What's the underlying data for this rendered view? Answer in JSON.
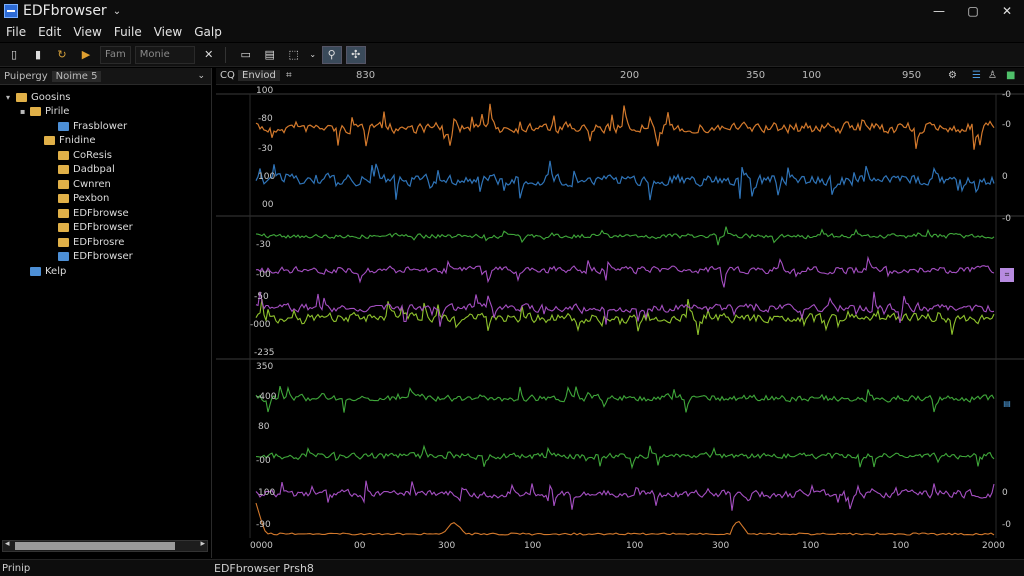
{
  "window": {
    "title": "EDFbrowser",
    "chevron": "⌄",
    "controls": [
      "—",
      "▢",
      "✕"
    ]
  },
  "menu": [
    "File",
    "Edit",
    "View",
    "Fuile",
    "View",
    "Galp"
  ],
  "toolbar": {
    "field1": "Fam",
    "field2": "Monie",
    "close": "✕"
  },
  "left_panel": {
    "tabs": [
      "Puipergy",
      "Noime 5"
    ],
    "tree": [
      {
        "label": "Goosins",
        "indent": 0,
        "icon": "folder",
        "expander": "▾"
      },
      {
        "label": "Pirile",
        "indent": 1,
        "icon": "folder",
        "expander": "▪"
      },
      {
        "label": "Frasblower",
        "indent": 3,
        "icon": "folder-blue",
        "expander": ""
      },
      {
        "label": "Fnidine",
        "indent": 2,
        "icon": "folder",
        "expander": ""
      },
      {
        "label": "CoResis",
        "indent": 3,
        "icon": "folder",
        "expander": ""
      },
      {
        "label": "Dadbpal",
        "indent": 3,
        "icon": "folder",
        "expander": ""
      },
      {
        "label": "Cwnren",
        "indent": 3,
        "icon": "folder",
        "expander": ""
      },
      {
        "label": "Pexbon",
        "indent": 3,
        "icon": "folder",
        "expander": ""
      },
      {
        "label": "EDFbrowse",
        "indent": 3,
        "icon": "folder",
        "expander": ""
      },
      {
        "label": "EDFbrowser",
        "indent": 3,
        "icon": "folder",
        "expander": ""
      },
      {
        "label": "EDFbrosre",
        "indent": 3,
        "icon": "folder",
        "expander": ""
      },
      {
        "label": "EDFbrowser",
        "indent": 3,
        "icon": "folder-blue",
        "expander": ""
      },
      {
        "label": "Kelp",
        "indent": 1,
        "icon": "folder-blue",
        "expander": ""
      }
    ]
  },
  "viewer": {
    "tab_icon": "CQ",
    "tab_label": "Enviod",
    "tab_grid": "⌗",
    "top_ticks": [
      "830",
      "200",
      "350",
      "100",
      "950"
    ],
    "left_labels": [
      "100",
      "-80",
      "-30",
      "100",
      "00",
      "-30",
      "-00",
      "-50",
      "-000",
      "-235",
      "350",
      "-400",
      "80",
      "-00",
      "100",
      "-90"
    ],
    "right_labels": [
      "-0",
      "-0",
      "0",
      "-0",
      "0",
      "-0"
    ],
    "bottom_ticks": [
      "0000",
      "00",
      "300",
      "100",
      "100",
      "300",
      "100",
      "100",
      "2000"
    ],
    "side_badges": [
      "⌗",
      "▤"
    ]
  },
  "status": {
    "left": "Prinip",
    "right": "EDFbrowser Prsh8"
  },
  "colors": {
    "orange": "#d3792c",
    "blue": "#2f74b8",
    "green": "#3fa73a",
    "purple": "#a54fc2",
    "lime": "#8fc32d",
    "sep": "#3a3a3a"
  }
}
